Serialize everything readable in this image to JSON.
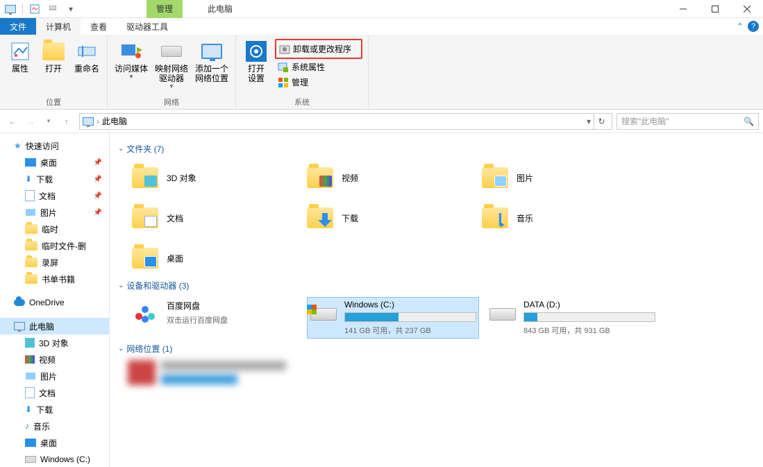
{
  "title_tab_manage": "管理",
  "title_tab_thispc": "此电脑",
  "menutabs": {
    "file": "文件",
    "computer": "计算机",
    "view": "查看",
    "drive_tools": "驱动器工具"
  },
  "ribbon": {
    "group_location": "位置",
    "group_network": "网络",
    "group_system": "系统",
    "properties": "属性",
    "open": "打开",
    "rename": "重命名",
    "access_media": "访问媒体",
    "map_network_drive": "映射网络\n驱动器",
    "add_network_location": "添加一个\n网络位置",
    "open_settings": "打开\n设置",
    "uninstall_or_change": "卸载或更改程序",
    "system_properties": "系统属性",
    "manage": "管理"
  },
  "address": {
    "root": "此电脑"
  },
  "search_placeholder": "搜索\"此电脑\"",
  "sidebar": {
    "quick_access": "快速访问",
    "desktop": "桌面",
    "downloads": "下载",
    "documents": "文档",
    "pictures": "图片",
    "temp": "临时",
    "temp_del": "临时文件-删",
    "recording": "录屏",
    "books": "书单书籍",
    "onedrive": "OneDrive",
    "this_pc": "此电脑",
    "objects3d": "3D 对象",
    "videos": "视频",
    "pictures2": "图片",
    "documents2": "文档",
    "downloads2": "下载",
    "music": "音乐",
    "desktop2": "桌面",
    "windows_c": "Windows (C:)"
  },
  "sections": {
    "folders_header": "文件夹 (7)",
    "devices_header": "设备和驱动器 (3)",
    "network_header": "网络位置 (1)"
  },
  "folders": {
    "objects3d": "3D 对象",
    "videos": "视频",
    "pictures": "图片",
    "documents": "文档",
    "downloads": "下载",
    "music": "音乐",
    "desktop": "桌面"
  },
  "drives": {
    "baidu_name": "百度网盘",
    "baidu_sub": "双击运行百度网盘",
    "c_name": "Windows (C:)",
    "c_sub": "141 GB 可用，共 237 GB",
    "c_fill_pct": 41,
    "d_name": "DATA (D:)",
    "d_sub": "843 GB 可用，共 931 GB",
    "d_fill_pct": 10
  }
}
